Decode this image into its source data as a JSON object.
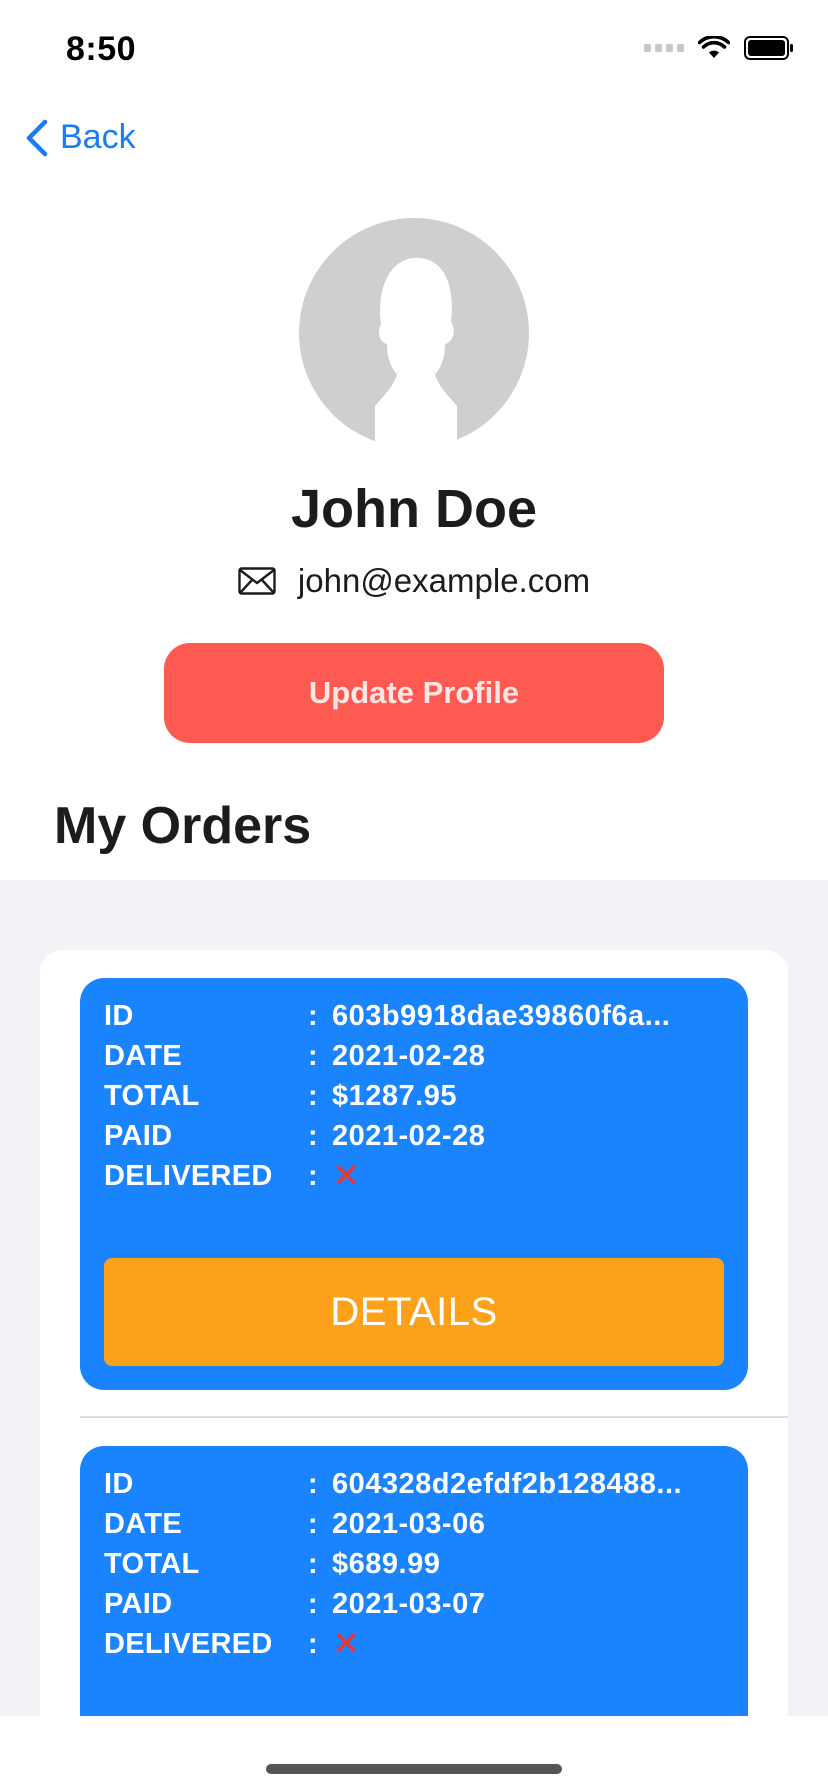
{
  "status_bar": {
    "time": "8:50"
  },
  "nav": {
    "back_label": "Back"
  },
  "profile": {
    "name": "John Doe",
    "email": "john@example.com",
    "update_button_label": "Update Profile"
  },
  "orders_section": {
    "title": "My Orders",
    "labels": {
      "id": "ID",
      "date": "DATE",
      "total": "TOTAL",
      "paid": "PAID",
      "delivered": "DELIVERED"
    },
    "colon": ":",
    "details_button_label": "DETAILS",
    "orders": [
      {
        "id": "603b9918dae39860f6a...",
        "date": "2021-02-28",
        "total": "$1287.95",
        "paid": "2021-02-28",
        "delivered_icon": "red-cross-icon"
      },
      {
        "id": "604328d2efdf2b128488...",
        "date": "2021-03-06",
        "total": "$689.99",
        "paid": "2021-03-07",
        "delivered_icon": "red-cross-icon"
      }
    ]
  },
  "colors": {
    "accent_blue": "#1a84fe",
    "link_blue": "#1a7cf5",
    "update_button_red": "#ff5a52",
    "details_button_orange": "#fea11a",
    "cross_red": "#e8343a",
    "list_background": "#f2f2f7"
  }
}
